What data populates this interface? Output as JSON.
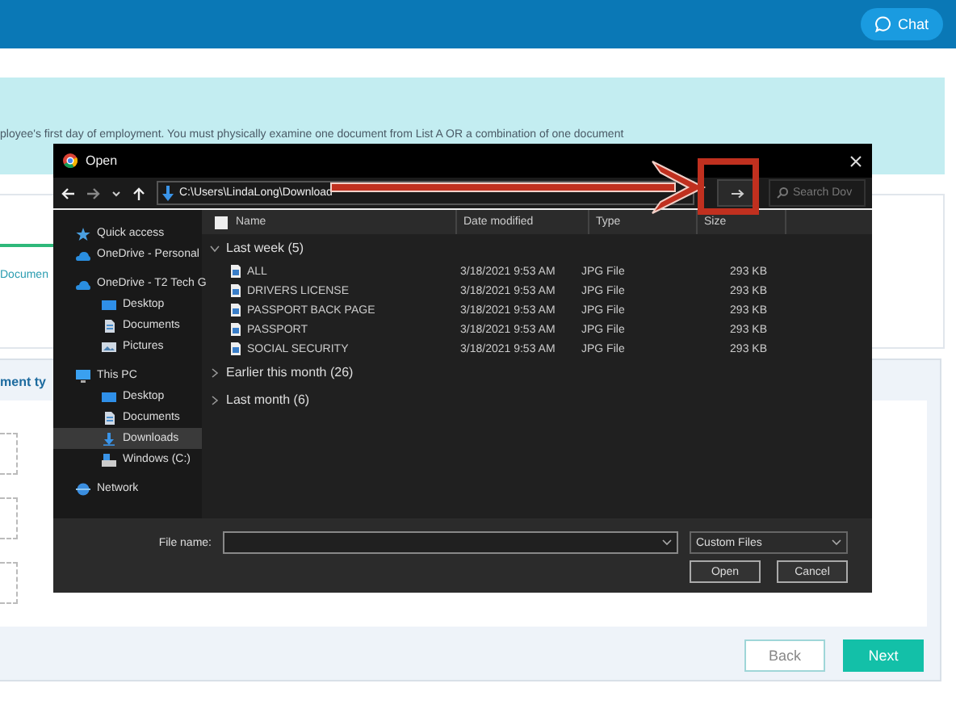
{
  "header": {
    "chat_button": "Chat"
  },
  "banner": {
    "text": "ployee's first day of employment. You must physically examine one document from List A OR a combination of one document"
  },
  "tab": {
    "label": "Documen",
    "selected": true
  },
  "section": {
    "heading": "ment ty",
    "upload_slots": [
      {
        "kind": "dashed"
      },
      {
        "kind": "dashed"
      },
      {
        "kind": "dashed"
      }
    ]
  },
  "footer": {
    "buttons": [
      {
        "label": "Back",
        "kind": "secondary"
      },
      {
        "label": "Next",
        "kind": "primary"
      }
    ]
  },
  "dialog": {
    "title": "Open",
    "path": "C:\\Users\\LindaLong\\Download",
    "search_placeholder": "Search Dov",
    "nav": [
      {
        "label": "Quick access",
        "kind": "star",
        "selected": false
      },
      {
        "label": "OneDrive - Personal",
        "kind": "cloud",
        "selected": false
      },
      {
        "label": "OneDrive - T2 Tech G",
        "kind": "cloud",
        "selected": false,
        "children": [
          {
            "label": "Desktop",
            "kind": "desktop",
            "selected": false
          },
          {
            "label": "Documents",
            "kind": "document",
            "selected": false
          },
          {
            "label": "Pictures",
            "kind": "picture",
            "selected": false
          }
        ]
      },
      {
        "label": "This PC",
        "kind": "pc",
        "selected": false,
        "children": [
          {
            "label": "Desktop",
            "kind": "desktop",
            "selected": false
          },
          {
            "label": "Documents",
            "kind": "document",
            "selected": false
          },
          {
            "label": "Downloads",
            "kind": "download",
            "selected": true
          },
          {
            "label": "Windows (C:)",
            "kind": "drive",
            "selected": false
          }
        ]
      },
      {
        "label": "Network",
        "kind": "network",
        "selected": false
      }
    ],
    "columns": [
      "Name",
      "Date modified",
      "Type",
      "Size"
    ],
    "select_all_checked": false,
    "groups": [
      {
        "label": "Last week (5)",
        "expanded": true,
        "files": [
          {
            "name": "ALL",
            "date": "3/18/2021 9:53 AM",
            "type": "JPG File",
            "size": "293 KB"
          },
          {
            "name": "DRIVERS LICENSE",
            "date": "3/18/2021 9:53 AM",
            "type": "JPG File",
            "size": "293 KB"
          },
          {
            "name": "PASSPORT BACK PAGE",
            "date": "3/18/2021 9:53 AM",
            "type": "JPG File",
            "size": "293 KB"
          },
          {
            "name": "PASSPORT",
            "date": "3/18/2021 9:53 AM",
            "type": "JPG File",
            "size": "293 KB"
          },
          {
            "name": "SOCIAL SECURITY",
            "date": "3/18/2021 9:53 AM",
            "type": "JPG File",
            "size": "293 KB"
          }
        ]
      },
      {
        "label": "Earlier this month (26)",
        "expanded": false
      },
      {
        "label": "Last month (6)",
        "expanded": false
      }
    ],
    "file_name_label": "File name:",
    "file_type": "Custom Files",
    "buttons": [
      "Open",
      "Cancel"
    ]
  }
}
